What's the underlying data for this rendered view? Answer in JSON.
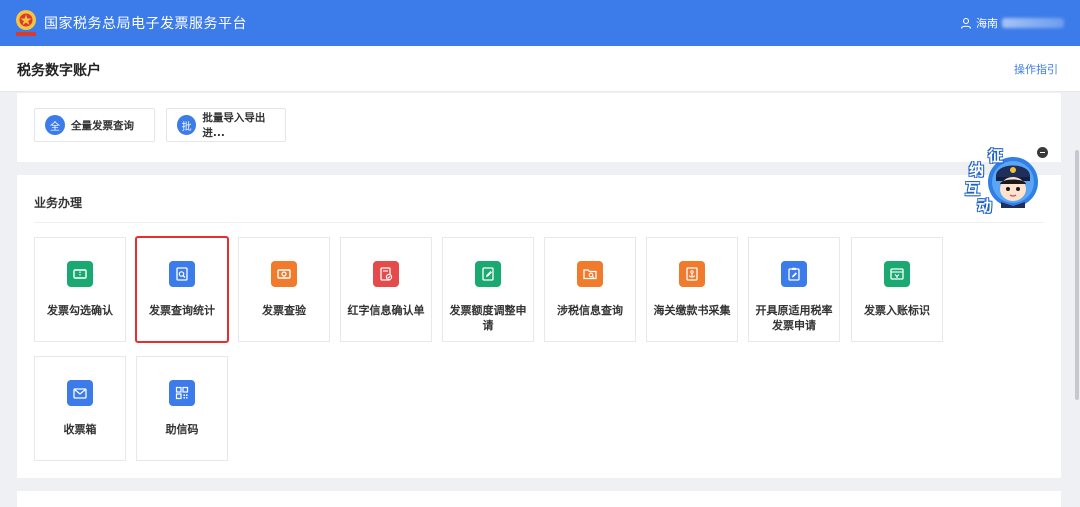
{
  "header": {
    "platform_title": "国家税务总局电子发票服务平台",
    "user_name": "海南"
  },
  "subheader": {
    "page_title": "税务数字账户",
    "guide_link": "操作指引"
  },
  "quick_actions": [
    {
      "badge": "全",
      "label": "全量发票查询"
    },
    {
      "badge": "批",
      "label": "批量导入导出进..."
    }
  ],
  "business": {
    "section_title": "业务办理",
    "tiles": [
      {
        "label": "发票勾选确认",
        "icon": "ticket-check-icon",
        "color": "#1aa971"
      },
      {
        "label": "发票查询统计",
        "icon": "document-search-icon",
        "color": "#3c7bea"
      },
      {
        "label": "发票查验",
        "icon": "ticket-verify-icon",
        "color": "#f07b2c"
      },
      {
        "label": "红字信息确认单",
        "icon": "red-invoice-icon",
        "color": "#e54b4b"
      },
      {
        "label": "发票额度调整申请",
        "icon": "quota-edit-icon",
        "color": "#1aa971"
      },
      {
        "label": "涉税信息查询",
        "icon": "folder-search-icon",
        "color": "#f07b2c"
      },
      {
        "label": "海关缴款书采集",
        "icon": "customs-anchor-icon",
        "color": "#f07b2c"
      },
      {
        "label": "开具原适用税率发票申请",
        "icon": "clipboard-edit-icon",
        "color": "#3c7bea"
      },
      {
        "label": "发票入账标识",
        "icon": "invoice-stamp-icon",
        "color": "#1aa971"
      },
      {
        "label": "收票箱",
        "icon": "mail-icon",
        "color": "#3c7bea"
      },
      {
        "label": "助信码",
        "icon": "qr-code-icon",
        "color": "#3c7bea"
      }
    ]
  },
  "mascot": {
    "chars": [
      "征",
      "纳",
      "互",
      "动"
    ]
  }
}
